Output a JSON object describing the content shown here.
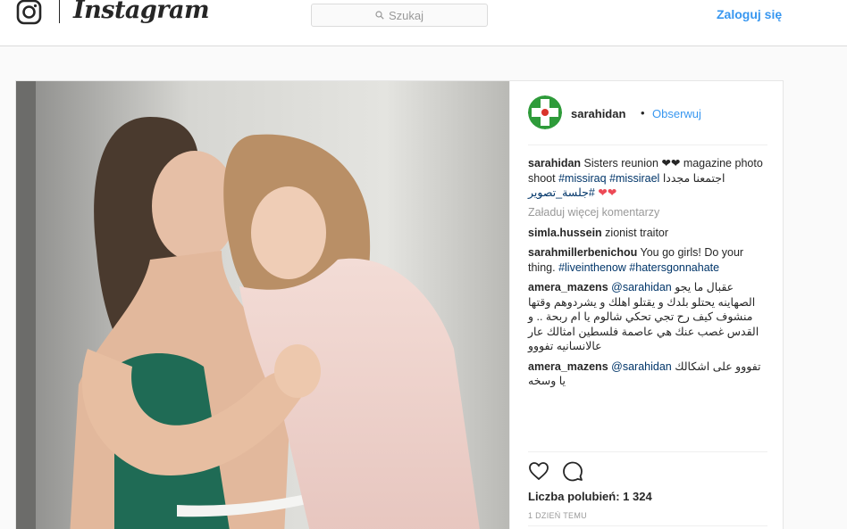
{
  "header": {
    "logo_icon": "instagram-camera-icon",
    "wordmark": "Instagram",
    "search_placeholder": "Szukaj",
    "search_icon": "magnifier-icon",
    "login_label": "Zaloguj się"
  },
  "post": {
    "photo_icon": "photo",
    "username": "sarahidan",
    "separator": "•",
    "follow_label": "Obserwuj",
    "caption": {
      "user": "sarahidan",
      "text_1": "Sisters reunion ❤❤ magazine photo shoot",
      "tag_1": "#missiraq",
      "tag_2": "#missirael",
      "text_2": "اجتمعنا مجددا",
      "tag_3": "#جلسة_تصوير",
      "hearts": "❤❤"
    },
    "load_more": "Załaduj więcej komentarzy",
    "comments": [
      {
        "user": "simla.hussein",
        "text": "zionist traitor"
      },
      {
        "user": "sarahmillerbenichou",
        "text": "You go girls! Do your thing.",
        "tags": "#liveinthenow #hatersgonnahate"
      },
      {
        "user": "amera_mazens",
        "mention": "@sarahidan",
        "text": "عقبال ما يجو الصهاينه يحتلو بلدك و يقتلو اهلك و يشردوهم وقتها منشوف كيف رح تجي تحكي شالوم يا ام ربحة .. و القدس غصب عنك هي عاصمة فلسطين امثالك عار عالانسانيه تفووو"
      },
      {
        "user": "amera_mazens",
        "mention": "@sarahidan",
        "text": "تفووو على اشكالك يا وسخه"
      }
    ],
    "like_icon": "heart-outline-icon",
    "comment_icon": "comment-bubble-icon",
    "likes": "Liczba polubień: 1 324",
    "time": "1 DZIEŃ TEMU"
  },
  "colors": {
    "accent": "#3897f0",
    "hashtag": "#003569",
    "muted": "#999999",
    "heart": "#ed4956"
  }
}
